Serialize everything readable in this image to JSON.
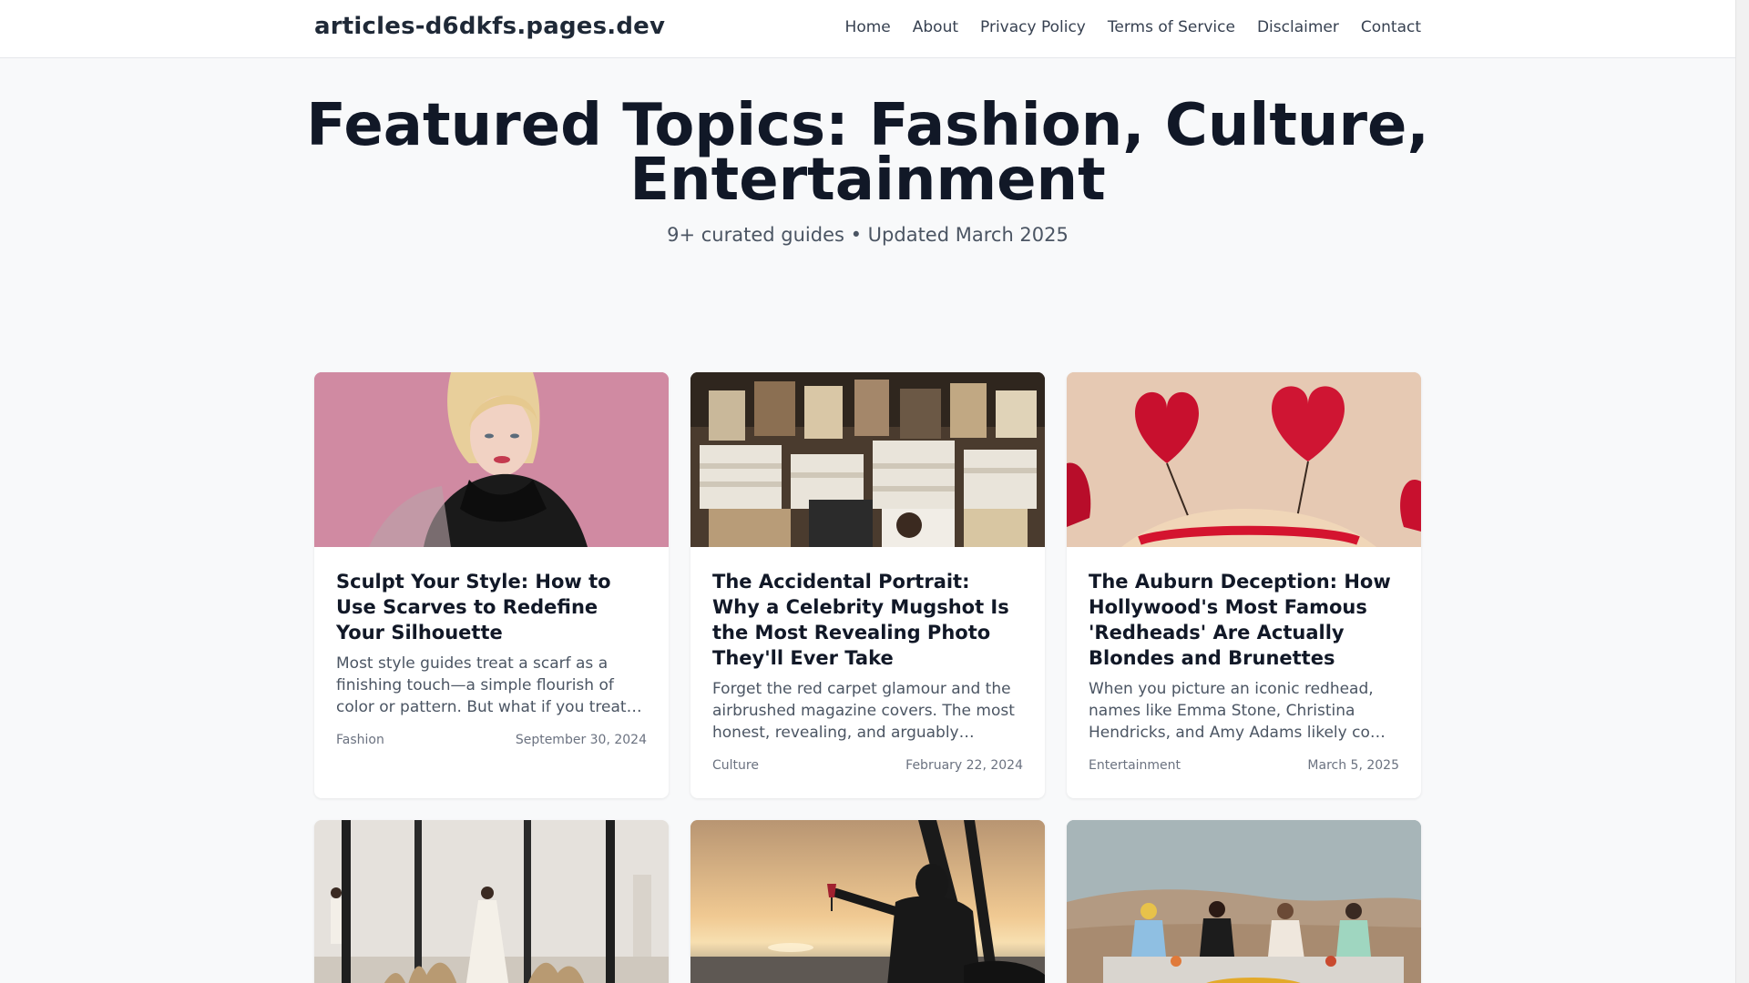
{
  "site": {
    "brand": "articles-d6dkfs.pages.dev",
    "nav": [
      "Home",
      "About",
      "Privacy Policy",
      "Terms of Service",
      "Disclaimer",
      "Contact"
    ]
  },
  "hero": {
    "title": "Featured Topics: Fashion, Culture, Entertainment",
    "subtitle": "9+ curated guides • Updated March 2025"
  },
  "cards": [
    {
      "title": "Sculpt Your Style: How to Use Scarves to Redefine Your Silhouette",
      "excerpt": "Most style guides treat a scarf as a finishing touch—a simple flourish of color or pattern. But what if you treated it not...",
      "category": "Fashion",
      "date": "September 30, 2024",
      "image": "woman-black-scarf-pink-background"
    },
    {
      "title": "The Accidental Portrait: Why a Celebrity Mugshot Is the Most Revealing Photo They'll Ever Take",
      "excerpt": "Forget the red carpet glamour and the airbrushed magazine covers. The most honest, revealing, and arguably powerful...",
      "category": "Culture",
      "date": "February 22, 2024",
      "image": "stacks-of-magazines"
    },
    {
      "title": "The Auburn Deception: How Hollywood's Most Famous 'Redheads' Are Actually Blondes and Brunettes",
      "excerpt": "When you picture an iconic redhead, names like Emma Stone, Christina Hendricks, and Amy Adams likely come ...",
      "category": "Entertainment",
      "date": "March 5, 2025",
      "image": "sequin-heart-headband"
    },
    {
      "title": "",
      "excerpt": "",
      "category": "",
      "date": "",
      "image": "runway-models-pampas-grass"
    },
    {
      "title": "",
      "excerpt": "",
      "category": "",
      "date": "",
      "image": "silhouette-with-wine-at-sunset"
    },
    {
      "title": "",
      "excerpt": "",
      "category": "",
      "date": "",
      "image": "women-dining-in-desert"
    }
  ]
}
